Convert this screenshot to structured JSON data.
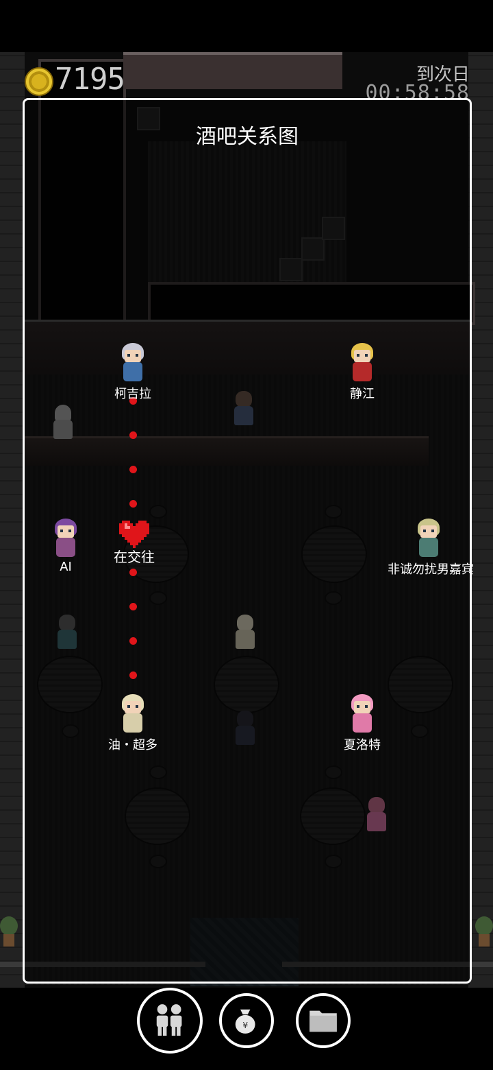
{
  "hud": {
    "gold": "7195",
    "timer_label": "到次日",
    "timer": "00:58:58"
  },
  "panel": {
    "title": "酒吧关系图",
    "characters": [
      {
        "name": "柯吉拉",
        "hair": "#c9c9d6",
        "body": "#3f6fa8"
      },
      {
        "name": "静江",
        "hair": "#e6c24a",
        "body": "#b52a2a"
      },
      {
        "name": "AI",
        "hair": "#7c4aa0",
        "body": "#8a4f86"
      },
      {
        "name": "非诚勿扰男嘉宾",
        "hair": "#c9c48a",
        "body": "#4c7c73"
      },
      {
        "name": "油・超多",
        "hair": "#e6ddb8",
        "body": "#d7ceaa"
      },
      {
        "name": "夏洛特",
        "hair": "#f29ac1",
        "body": "#e07aa8"
      }
    ],
    "relationship": {
      "label": "在交往",
      "from": "柯吉拉",
      "to": "油・超多",
      "line_color": "#e0151a",
      "icon": "heart-icon"
    }
  },
  "toolbar": {
    "buttons": [
      {
        "icon": "people-icon",
        "label": ""
      },
      {
        "icon": "money-bag-icon",
        "label": ""
      },
      {
        "icon": "folder-icon",
        "label": ""
      }
    ]
  }
}
